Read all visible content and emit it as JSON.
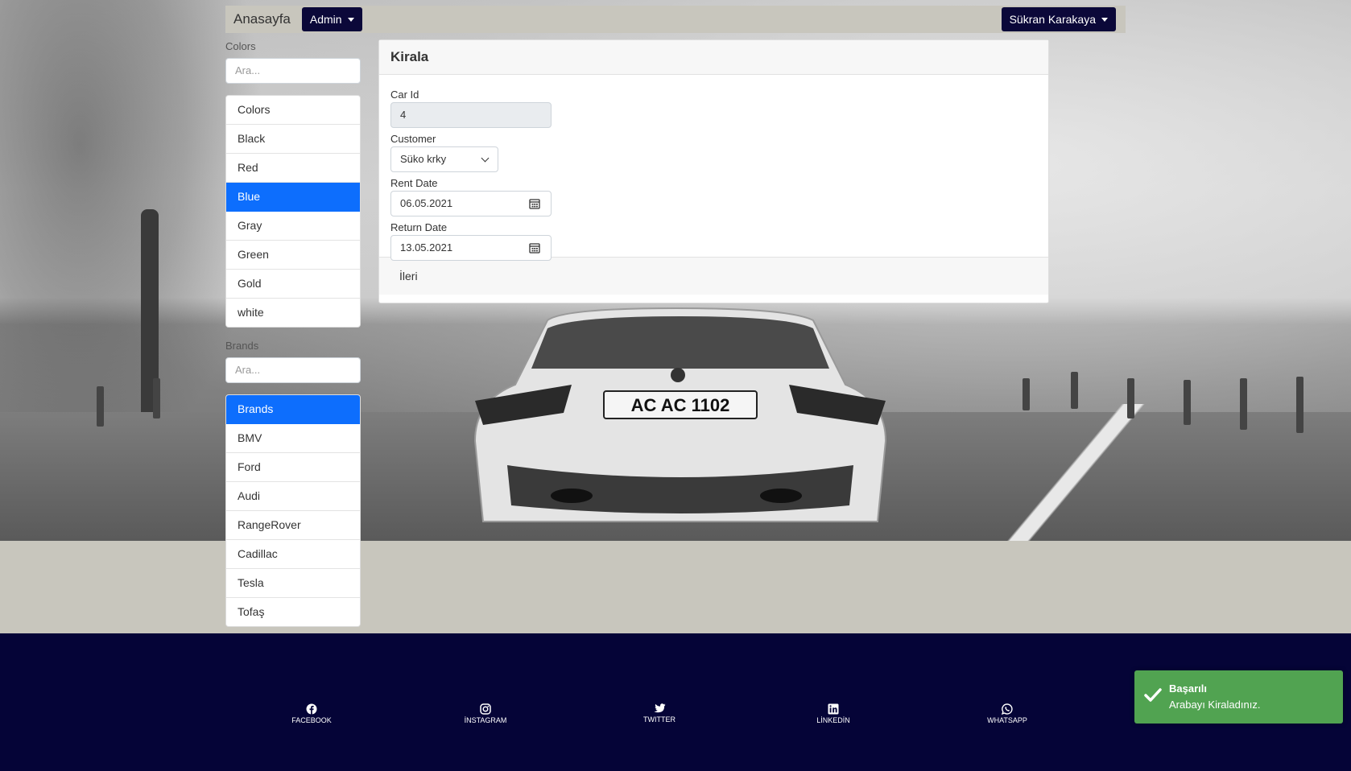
{
  "navbar": {
    "brand": "Anasayfa",
    "admin_label": "Admin",
    "user_label": "Sükran Karakaya"
  },
  "colors_filter": {
    "heading": "Colors",
    "search_placeholder": "Ara...",
    "items": [
      {
        "label": "Colors"
      },
      {
        "label": "Black"
      },
      {
        "label": "Red"
      },
      {
        "label": "Blue",
        "active": true
      },
      {
        "label": "Gray"
      },
      {
        "label": "Green"
      },
      {
        "label": "Gold"
      },
      {
        "label": "white"
      }
    ]
  },
  "brands_filter": {
    "heading": "Brands",
    "search_placeholder": "Ara...",
    "items": [
      {
        "label": "Brands",
        "active": true
      },
      {
        "label": "BMV"
      },
      {
        "label": "Ford"
      },
      {
        "label": "Audi"
      },
      {
        "label": "RangeRover"
      },
      {
        "label": "Cadillac"
      },
      {
        "label": "Tesla"
      },
      {
        "label": "Tofaş"
      }
    ]
  },
  "rent_form": {
    "title": "Kirala",
    "car_id_label": "Car Id",
    "car_id_value": "4",
    "customer_label": "Customer",
    "customer_value": "Süko krky",
    "rent_date_label": "Rent Date",
    "rent_date_value": "06.05.2021",
    "return_date_label": "Return Date",
    "return_date_value": "13.05.2021",
    "next_label": "İleri"
  },
  "footer": {
    "social": [
      {
        "label": "FACEBOOK",
        "icon": "facebook-icon"
      },
      {
        "label": "İNSTAGRAM",
        "icon": "instagram-icon"
      },
      {
        "label": "TWITTER",
        "icon": "twitter-icon"
      },
      {
        "label": "LİNKEDİN",
        "icon": "linkedin-icon"
      },
      {
        "label": "WHATSAPP",
        "icon": "whatsapp-icon"
      }
    ]
  },
  "toast": {
    "title": "Başarılı",
    "message": "Arabayı Kiraladınız.",
    "color": "#51a351"
  },
  "car_plate": "AC AC 1102"
}
